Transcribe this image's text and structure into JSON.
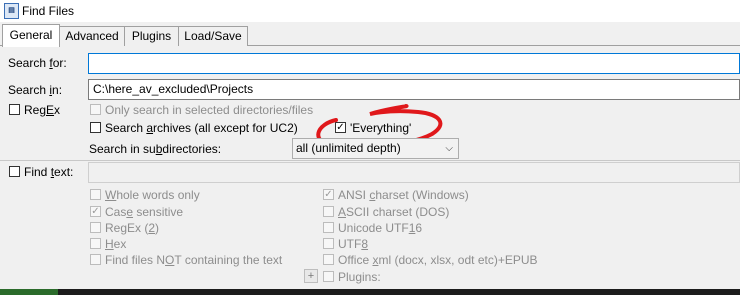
{
  "window": {
    "title": "Find Files"
  },
  "tabs": [
    "General",
    "Advanced",
    "Plugins",
    "Load/Save"
  ],
  "search_for": {
    "label": "Search for:",
    "value": ""
  },
  "search_in": {
    "label": "Search in:",
    "value": "C:\\here_av_excluded\\Projects"
  },
  "regex_top": {
    "label": "RegEx"
  },
  "only_selected": {
    "label": "Only search in selected directories/files"
  },
  "search_archives": {
    "label": "Search archives (all except for UC2)"
  },
  "everything": {
    "label": "'Everything'",
    "checked": true
  },
  "subdirs": {
    "label": "Search in subdirectories:",
    "value": "all (unlimited depth)"
  },
  "find_text": {
    "label": "Find text:",
    "value": ""
  },
  "options_left": [
    {
      "label": "Whole words only",
      "checked": false
    },
    {
      "label": "Case sensitive",
      "checked": true
    },
    {
      "label": "RegEx (2)",
      "checked": false
    },
    {
      "label": "Hex",
      "checked": false
    },
    {
      "label": "Find files NOT containing the text",
      "checked": false
    }
  ],
  "options_right": [
    {
      "label": "ANSI charset (Windows)",
      "checked": true
    },
    {
      "label": "ASCII charset (DOS)",
      "checked": false
    },
    {
      "label": "Unicode UTF16",
      "checked": false
    },
    {
      "label": "UTF8",
      "checked": false
    },
    {
      "label": "Office xml (docx, xlsx, odt etc)+EPUB",
      "checked": false
    },
    {
      "label": "Plugins:",
      "checked": false
    }
  ],
  "plus_button": "+",
  "annotation_color": "#e0181b"
}
